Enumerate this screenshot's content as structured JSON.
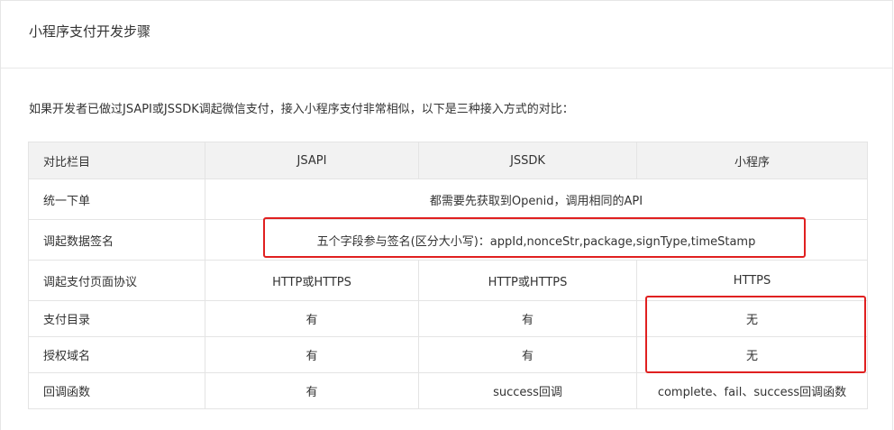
{
  "page": {
    "title": "小程序支付开发步骤",
    "intro": "如果开发者已做过JSAPI或JSSDK调起微信支付，接入小程序支付非常相似，以下是三种接入方式的对比："
  },
  "table": {
    "headers": [
      "对比栏目",
      "JSAPI",
      "JSSDK",
      "小程序"
    ],
    "rows": [
      {
        "label": "统一下单",
        "merged": "都需要先获取到Openid，调用相同的API"
      },
      {
        "label": "调起数据签名",
        "merged": "五个字段参与签名(区分大小写)：appId,nonceStr,package,signType,timeStamp"
      },
      {
        "label": "调起支付页面协议",
        "cells": [
          "HTTP或HTTPS",
          "HTTP或HTTPS",
          "HTTPS"
        ]
      },
      {
        "label": "支付目录",
        "cells": [
          "有",
          "有",
          "无"
        ]
      },
      {
        "label": "授权域名",
        "cells": [
          "有",
          "有",
          "无"
        ]
      },
      {
        "label": "回调函数",
        "cells": [
          "有",
          "success回调",
          "complete、fail、success回调函数"
        ]
      }
    ]
  },
  "colors": {
    "highlight_border": "#e02020",
    "header_bg": "#f2f2f2",
    "border": "#e4e4e4"
  }
}
